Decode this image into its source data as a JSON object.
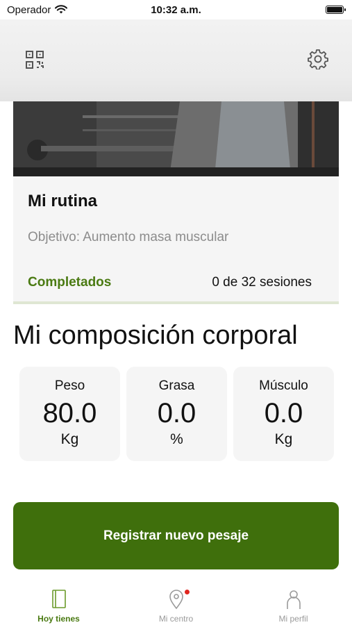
{
  "status_bar": {
    "carrier": "Operador",
    "time": "10:32 a.m."
  },
  "header": {
    "icons": [
      "qr-code-icon",
      "gear-icon"
    ]
  },
  "routine_card": {
    "title": "Mi rutina",
    "objective": "Objetivo: Aumento masa muscular",
    "completed_label": "Completados",
    "sessions_text": "0 de 32 sesiones",
    "progress_fraction": 0.0
  },
  "composition": {
    "title": "Mi composición corporal",
    "metrics": [
      {
        "label": "Peso",
        "value": "80.0",
        "unit": "Kg"
      },
      {
        "label": "Grasa",
        "value": "0.0",
        "unit": "%"
      },
      {
        "label": "Músculo",
        "value": "0.0",
        "unit": "Kg"
      }
    ]
  },
  "primary_button": {
    "label": "Registrar nuevo pesaje"
  },
  "tab_bar": {
    "tabs": [
      {
        "label": "Hoy tienes",
        "icon": "notebook-icon",
        "active": true
      },
      {
        "label": "Mi centro",
        "icon": "location-pin-icon",
        "active": false,
        "badge": true
      },
      {
        "label": "Mi perfil",
        "icon": "person-icon",
        "active": false
      }
    ]
  },
  "colors": {
    "accent_green": "#3f6f0c",
    "text_green": "#4a7a12",
    "badge_red": "#e0261f"
  }
}
